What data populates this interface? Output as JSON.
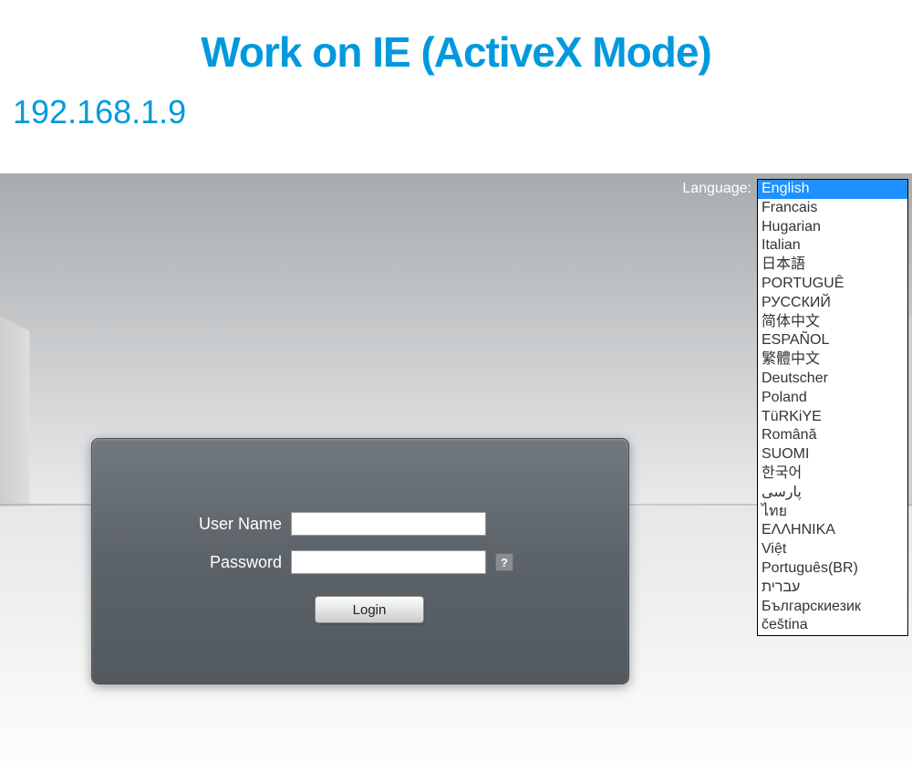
{
  "header": {
    "title": "Work on IE (ActiveX Mode)",
    "ip": "192.168.1.9"
  },
  "language": {
    "label": "Language:",
    "selected": "English",
    "options": [
      "English",
      "Francais",
      "Hugarian",
      "Italian",
      "日本語",
      "PORTUGUÊ",
      "РУССКИЙ",
      "简体中文",
      "ESPAÑOL",
      "繁體中文",
      "Deutscher",
      "Poland",
      "TüRKiYE",
      "Română",
      "SUOMI",
      "한국어",
      "پارسی",
      "ไทย",
      "ΕΛΛΗΝΙΚΑ",
      "Việt",
      "Português(BR)",
      "עברית",
      "Българскиезик",
      "čeština"
    ]
  },
  "login": {
    "username_label": "User Name",
    "password_label": "Password",
    "username_value": "",
    "password_value": "",
    "help_text": "?",
    "button_label": "Login"
  }
}
